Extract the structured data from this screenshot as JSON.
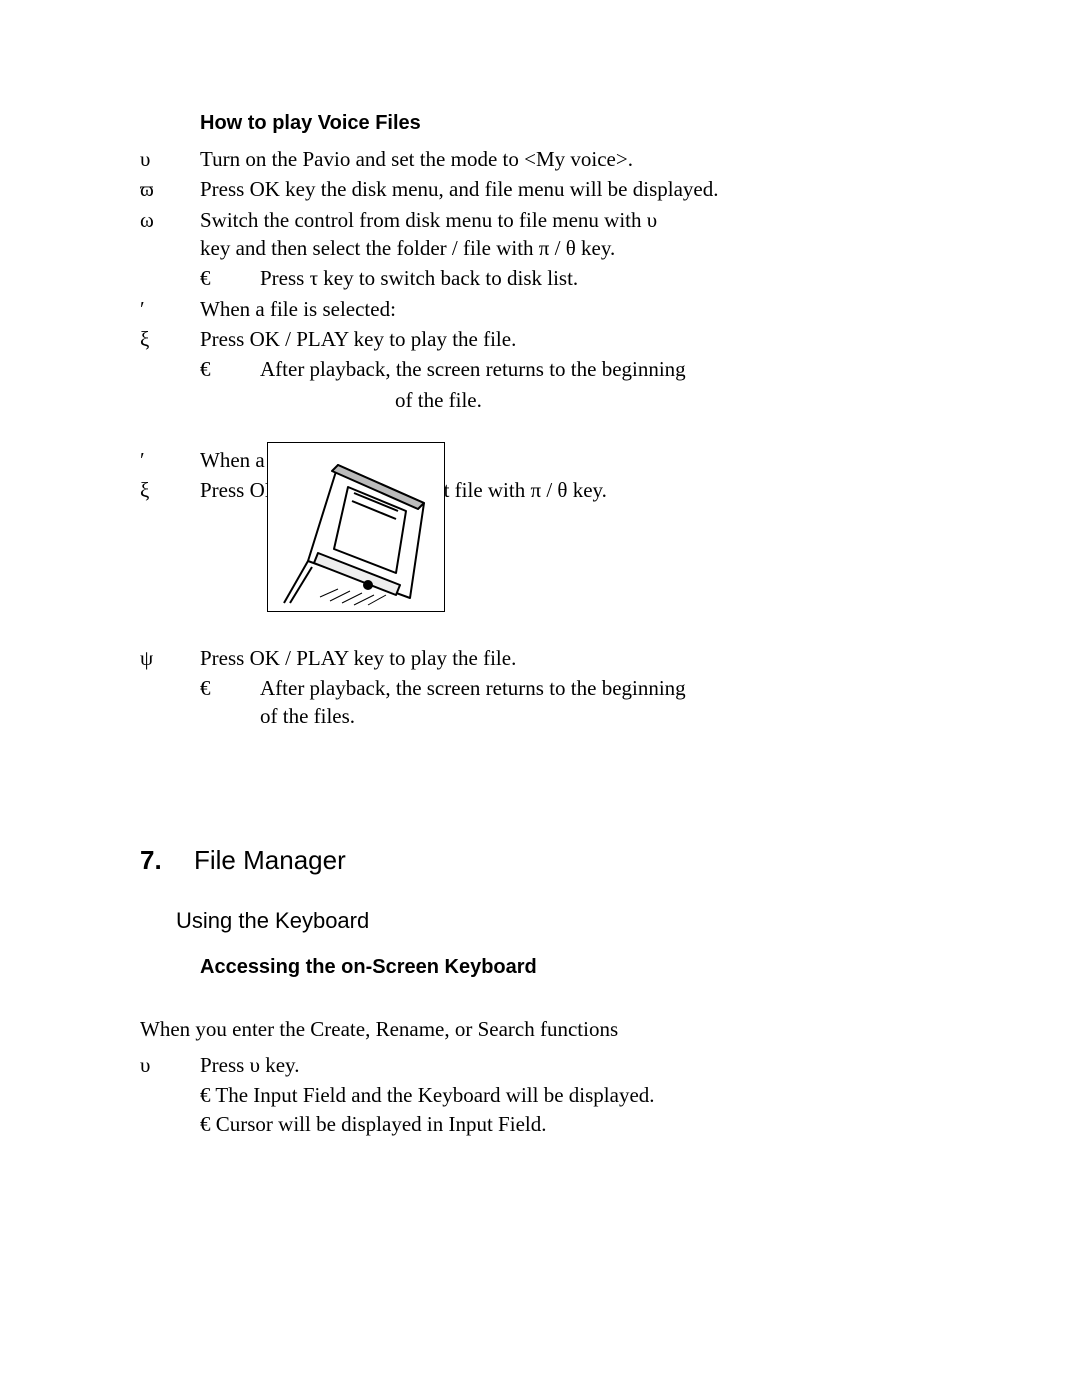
{
  "section_voice": {
    "heading": "How to play Voice Files",
    "items": [
      {
        "bullet": "υ",
        "text": "Turn on the Pavio  and set the mode to <My voice>."
      },
      {
        "bullet": "ϖ",
        "text": "Press OK key the disk menu, and file menu will be displayed."
      },
      {
        "bullet": "ω",
        "text": "Switch the control from disk menu to file menu with υ",
        "cont": "key and then select the folder / file with π / θ key.",
        "sub": {
          "bullet": "€",
          "text": "Press τ key to switch back to disk list."
        }
      },
      {
        "bullet": "′",
        "text": "When a file is selected:"
      },
      {
        "bullet": "ξ",
        "text": "Press OK / PLAY key to play the file.",
        "sub": {
          "bullet": "€",
          "text": "After playback, the screen returns to the beginning",
          "cont_center": "of the file."
        }
      },
      {
        "bullet": "′",
        "text": "When a folder is selected:"
      },
      {
        "bullet": "ξ",
        "text": "Press OK key, and then select file with π / θ key."
      },
      {
        "bullet": "ψ",
        "text": "Press OK / PLAY key to play the file.",
        "sub": {
          "bullet": "€",
          "text": "After playback, the screen returns to the beginning",
          "cont_left": " of the files."
        }
      }
    ]
  },
  "section_fm": {
    "num": "7.",
    "title": "File Manager",
    "sub": "Using the Keyboard",
    "heading": "Accessing the on-Screen Keyboard",
    "intro": "When you enter the Create, Rename, or Search functions",
    "items": [
      {
        "bullet": "υ",
        "text": "Press υ key.",
        "subs": [
          {
            "bullet": "€",
            "text": " The Input Field and the Keyboard will be displayed."
          },
          {
            "bullet": "€",
            "text": " Cursor will be displayed in Input Field."
          }
        ]
      }
    ]
  }
}
